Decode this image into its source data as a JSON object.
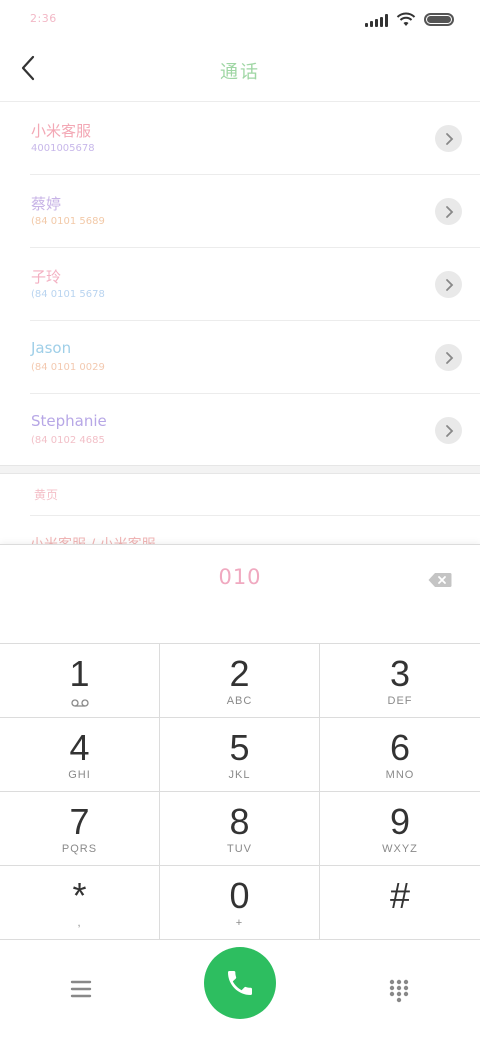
{
  "status_bar": {
    "time": "2:36"
  },
  "header": {
    "title": "通话"
  },
  "contacts": [
    {
      "name": "小米客服",
      "number": "4001005678",
      "name_color": "#f3a8b5",
      "number_color": "#c8b8ea"
    },
    {
      "name": "蔡婷",
      "number": "(84 0101 5689",
      "name_color": "#c7b3e6",
      "number_color": "#f2c9a8"
    },
    {
      "name": "子玲",
      "number": "(84 0101 5678",
      "name_color": "#f3b0c2",
      "number_color": "#b9d4f0"
    },
    {
      "name": "Jason",
      "number": "(84 0101 0029",
      "name_color": "#9fcfe8",
      "number_color": "#f3c9b0"
    },
    {
      "name": "Stephanie",
      "number": "(84 0102 4685",
      "name_color": "#b7a7e6",
      "number_color": "#f2c0c8"
    }
  ],
  "section": {
    "label": "黄页",
    "peek_text": "小米客服 / 小米客服"
  },
  "dialer": {
    "typed_number": "010",
    "typed_color": "#f0a9c0",
    "keys": [
      {
        "digit": "1",
        "letters": "oo"
      },
      {
        "digit": "2",
        "letters": "ABC"
      },
      {
        "digit": "3",
        "letters": "DEF"
      },
      {
        "digit": "4",
        "letters": "GHI"
      },
      {
        "digit": "5",
        "letters": "JKL"
      },
      {
        "digit": "6",
        "letters": "MNO"
      },
      {
        "digit": "7",
        "letters": "PQRS"
      },
      {
        "digit": "8",
        "letters": "TUV"
      },
      {
        "digit": "9",
        "letters": "WXYZ"
      },
      {
        "digit": "*",
        "letters": ","
      },
      {
        "digit": "0",
        "letters": "+"
      },
      {
        "digit": "#",
        "letters": ""
      }
    ]
  },
  "icons": {
    "back": "chevron-left-icon",
    "detail": "chevron-right-icon",
    "backspace": "backspace-icon",
    "menu": "menu-icon",
    "call": "phone-icon",
    "dialpad": "dialpad-icon",
    "voicemail": "voicemail-icon"
  },
  "colors": {
    "call_button": "#2dbe60",
    "title": "#9fd6a4"
  }
}
